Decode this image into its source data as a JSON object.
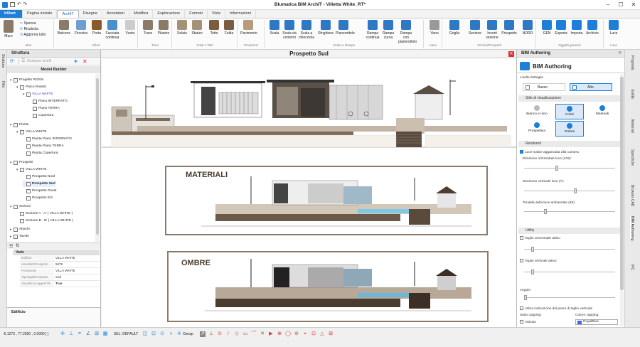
{
  "window": {
    "title": "Blumatica BIM ArchIT - Villetta White_RT*"
  },
  "tabs": [
    "bStart",
    "Pagina iniziale",
    "ArchIT",
    "Disegna",
    "Annotatori",
    "Modifica",
    "Esplorazione",
    "Formati",
    "Vista",
    "Informazioni"
  ],
  "ribbon": {
    "muro": "Muro",
    "spezza": "Spezza",
    "ricalcola": "Ricalcola",
    "aggiorna": "Aggiorna tutto",
    "buttons": [
      "Balcone",
      "Finestra",
      "Porta",
      "Facciata continua",
      "Vuoto",
      "Trave",
      "Pilastro",
      "Solaio",
      "Sbalzo",
      "Tetto",
      "Falda",
      "Pavimento",
      "Scala",
      "Scala da contorni",
      "Scala a chiocciola",
      "Ringhiera",
      "Pianerottolo",
      "Rampa continua",
      "Rampa curva",
      "Rampa con pianerottolo",
      "Vano",
      "Griglia",
      "Sezione",
      "Inverti sezione",
      "Prospetto",
      "NORD",
      "GEN",
      "Esporta",
      "Importa",
      "Archivio",
      "Luce"
    ],
    "groups": [
      "Muri",
      "Infissi",
      "Travi",
      "Solai e Tetti",
      "Pavimenti",
      "Scale e Rampe",
      "Vano",
      "Sezioni/Prospetti",
      "Oggetti generici",
      "Luce"
    ]
  },
  "left_tabs": [
    "Struttura",
    "Filtri"
  ],
  "struttura": {
    "title": "Struttura",
    "gestione_livelli": "Gestione Livelli",
    "model_builder": "Model Builder",
    "tree": [
      {
        "label": "Progetto ROSSI",
        "level": 0
      },
      {
        "label": "Parco Rosetti",
        "level": 1
      },
      {
        "label": "VILLA WHITE",
        "level": 2
      },
      {
        "label": "Piano INTERRATO",
        "level": 3
      },
      {
        "label": "Piano TERRA",
        "level": 3
      },
      {
        "label": "Copertura",
        "level": 3
      },
      {
        "label": "Piante",
        "level": 0
      },
      {
        "label": "VILLA WHITE",
        "level": 1
      },
      {
        "label": "Pianta Piano INTERRATO",
        "level": 2
      },
      {
        "label": "Pianta Piano TERRA",
        "level": 2
      },
      {
        "label": "Pianta Copertura",
        "level": 2
      },
      {
        "label": "Prospetti",
        "level": 0
      },
      {
        "label": "VILLA WHITE",
        "level": 1
      },
      {
        "label": "Prospetto Nord",
        "level": 2
      },
      {
        "label": "Prospetto Sud",
        "level": 2
      },
      {
        "label": "Prospetto Ovest",
        "level": 2
      },
      {
        "label": "Prospetto Est",
        "level": 2
      },
      {
        "label": "Sezioni",
        "level": 0
      },
      {
        "label": "Sezione A - A' ( VILLA WHITE )",
        "level": 1
      },
      {
        "label": "Sezione B - B' ( VILLA WHITE )",
        "level": 1
      },
      {
        "label": "Abachi",
        "level": 0
      },
      {
        "label": "Tavole",
        "level": 0
      }
    ],
    "props_group": "Varie",
    "props": [
      {
        "k": "Edificio",
        "v": "VILLA WHITE"
      },
      {
        "k": "HandleDiProspetto",
        "v": "5679"
      },
      {
        "k": "Posizional",
        "v": "VILLA WHITE"
      },
      {
        "k": "TipologiaProspetto",
        "v": "Sud"
      },
      {
        "k": "Visualizza oggetti fill",
        "v": "True"
      }
    ],
    "footer": "Edificio"
  },
  "center": {
    "title": "Prospetto Sud",
    "materiali": "MATERIALI",
    "ombre": "OMBRE"
  },
  "bim": {
    "panel_title": "BIM Authoring",
    "header": "BIM Authoring",
    "livello_label": "Livello dettaglio",
    "basso": "Basso",
    "alto": "Alto",
    "stile_section": "Stile di visualizzazione",
    "stili": [
      "Bianco e nero",
      "Colori",
      "Materiali",
      "Prospettiva",
      "Ombre"
    ],
    "rendered_section": "Rendered",
    "luce_check": "Luce solare agganciata alla camera",
    "dir_orizz": "Direzione orizzontale luce (102):",
    "dir_vert": "Direzione verticale luce (7):",
    "tonalita": "Tonalità della luce ambientale (48):",
    "utility_section": "Utility",
    "taglio_orizz": "Taglio orizzontale attivo",
    "taglio_vert": "Taglio verticale attivo",
    "angolo": "Angolo",
    "attiva_piano": "Attiva indicazione del piano di taglio verticale",
    "stato_capping": "Stato capping:",
    "colore_capping": "Colore capping:",
    "attivato": "Attivato",
    "royal_blue": "RoyalBlue"
  },
  "right_tabs": [
    "Proprietà",
    "Entità",
    "Materiali",
    "Specifiche",
    "Browser CAD",
    "BIM Authoring",
    "IFC"
  ],
  "status": {
    "coords": "-5.1273 , 77.2550 , 0.0000 [ ]",
    "sel": "SEL: DEFAULT",
    "osnap": "Osnap"
  },
  "colors": {
    "accent": "#1e7fd8",
    "active_style": "#dbe8f7"
  }
}
